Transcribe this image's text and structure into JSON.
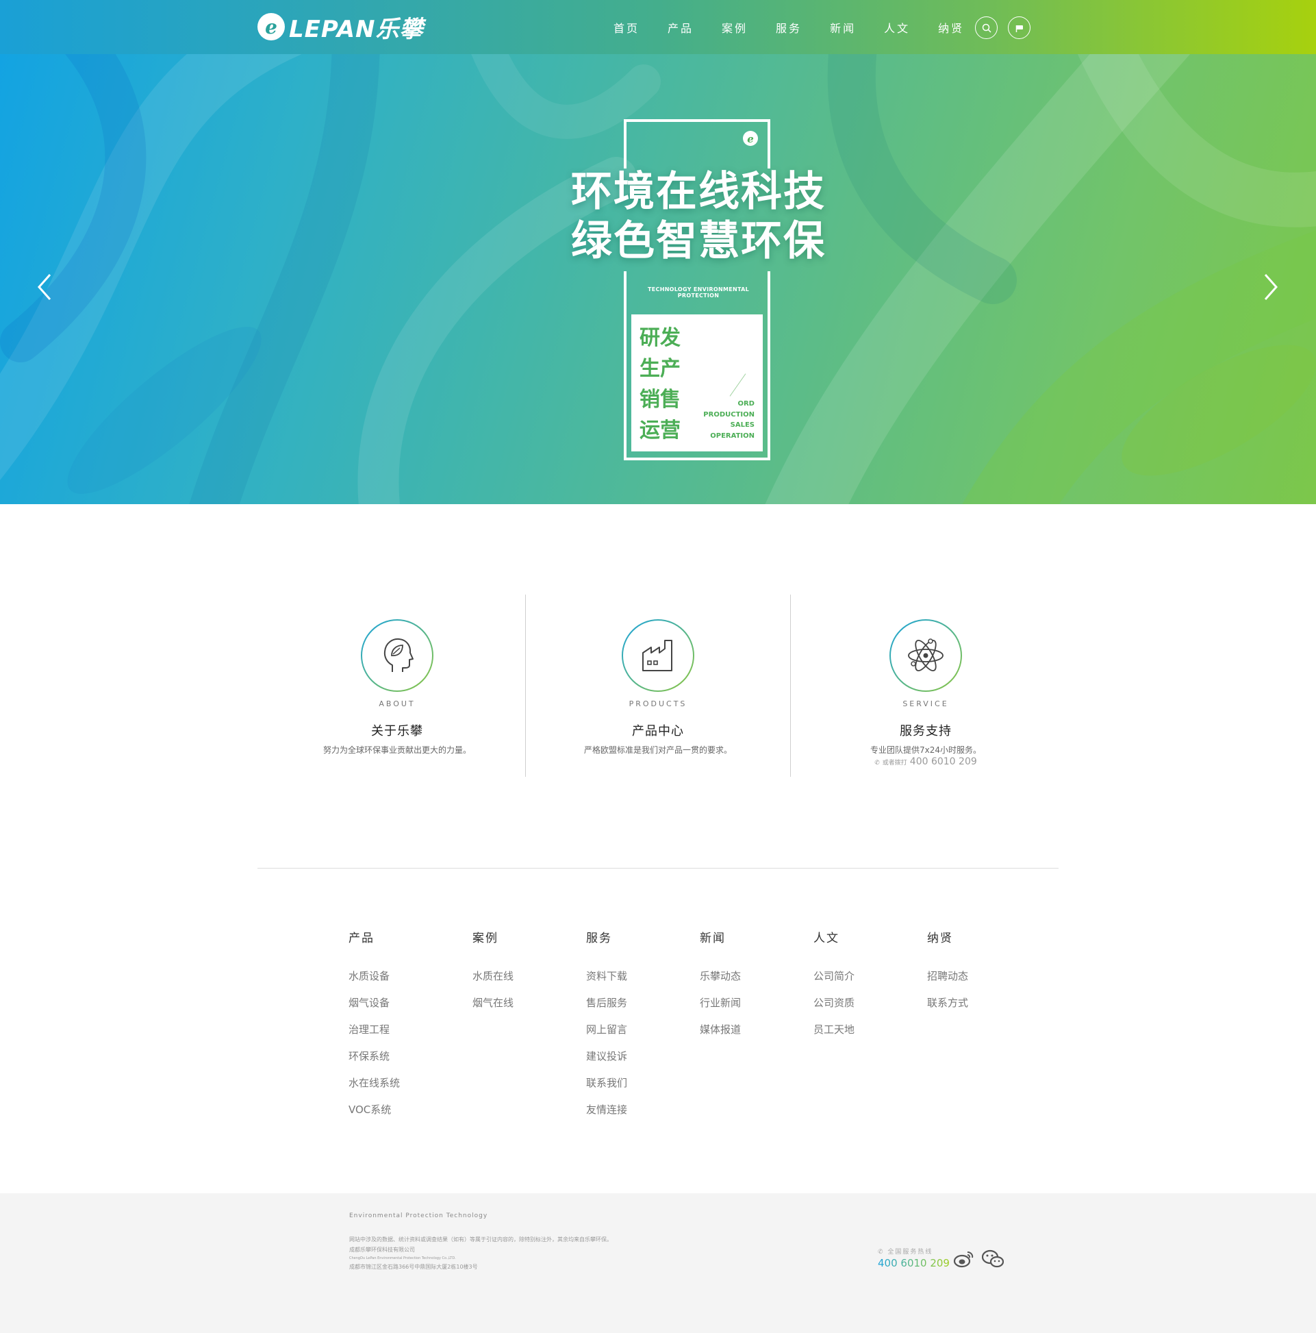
{
  "header": {
    "logo_mark": "e",
    "logo_text": "LEPAN乐攀",
    "nav": [
      "首页",
      "产品",
      "案例",
      "服务",
      "新闻",
      "人文",
      "纳贤"
    ],
    "icons": [
      "search-icon",
      "flag-icon"
    ]
  },
  "banner": {
    "title_line1": "环境在线科技",
    "title_line2": "绿色智慧环保",
    "subtitle": "TECHNOLOGY  ENVIRONMENTAL  PROTECTION",
    "card_cn": [
      "研发",
      "生产",
      "销售",
      "运营"
    ],
    "card_en": [
      "ORD",
      "PRODUCTION",
      "SALES",
      "OPERATION"
    ]
  },
  "features": [
    {
      "en": "ABOUT",
      "title": "关于乐攀",
      "desc": "努力为全球环保事业贡献出更大的力量。",
      "icon": "head-leaf-icon"
    },
    {
      "en": "PRODUCTS",
      "title": "产品中心",
      "desc": "严格欧盟标准是我们对产品一贯的要求。",
      "icon": "factory-icon"
    },
    {
      "en": "SERVICE",
      "title": "服务支持",
      "desc": "专业团队提供7x24小时服务。",
      "phone_label": "或者拨打",
      "phone": "400 6010 209",
      "icon": "atom-icon"
    }
  ],
  "sitemap": [
    {
      "title": "产品",
      "links": [
        "水质设备",
        "烟气设备",
        "治理工程",
        "环保系统",
        "水在线系统",
        "VOC系统"
      ]
    },
    {
      "title": "案例",
      "links": [
        "水质在线",
        "烟气在线"
      ]
    },
    {
      "title": "服务",
      "links": [
        "资料下载",
        "售后服务",
        "网上留言",
        "建议投诉",
        "联系我们",
        "友情连接"
      ]
    },
    {
      "title": "新闻",
      "links": [
        "乐攀动态",
        "行业新闻",
        "媒体报道"
      ]
    },
    {
      "title": "人文",
      "links": [
        "公司简介",
        "公司资质",
        "员工天地"
      ]
    },
    {
      "title": "纳贤",
      "links": [
        "招聘动态",
        "联系方式"
      ]
    }
  ],
  "footer": {
    "tagline": "Environmental  Protection  Technology",
    "disclaimer": "网站中涉及的数据、统计资料或调查结果（如有）等属于引证内容的，除特别标注外，其余均来自乐攀环保。",
    "company": "成都乐攀环保科技有限公司",
    "company_en": "ChengDu LePan Environmental Protection Technology Co.,LTD.",
    "address": "成都市锦江区金石路366号中鼎国际大厦2栋10楼3号",
    "hotline_label": "全国服务热线",
    "hotline": "400 6010 209"
  },
  "colors": {
    "brand_blue": "#1aa0d6",
    "brand_green": "#a7d10e",
    "accent_green": "#4cae56"
  }
}
